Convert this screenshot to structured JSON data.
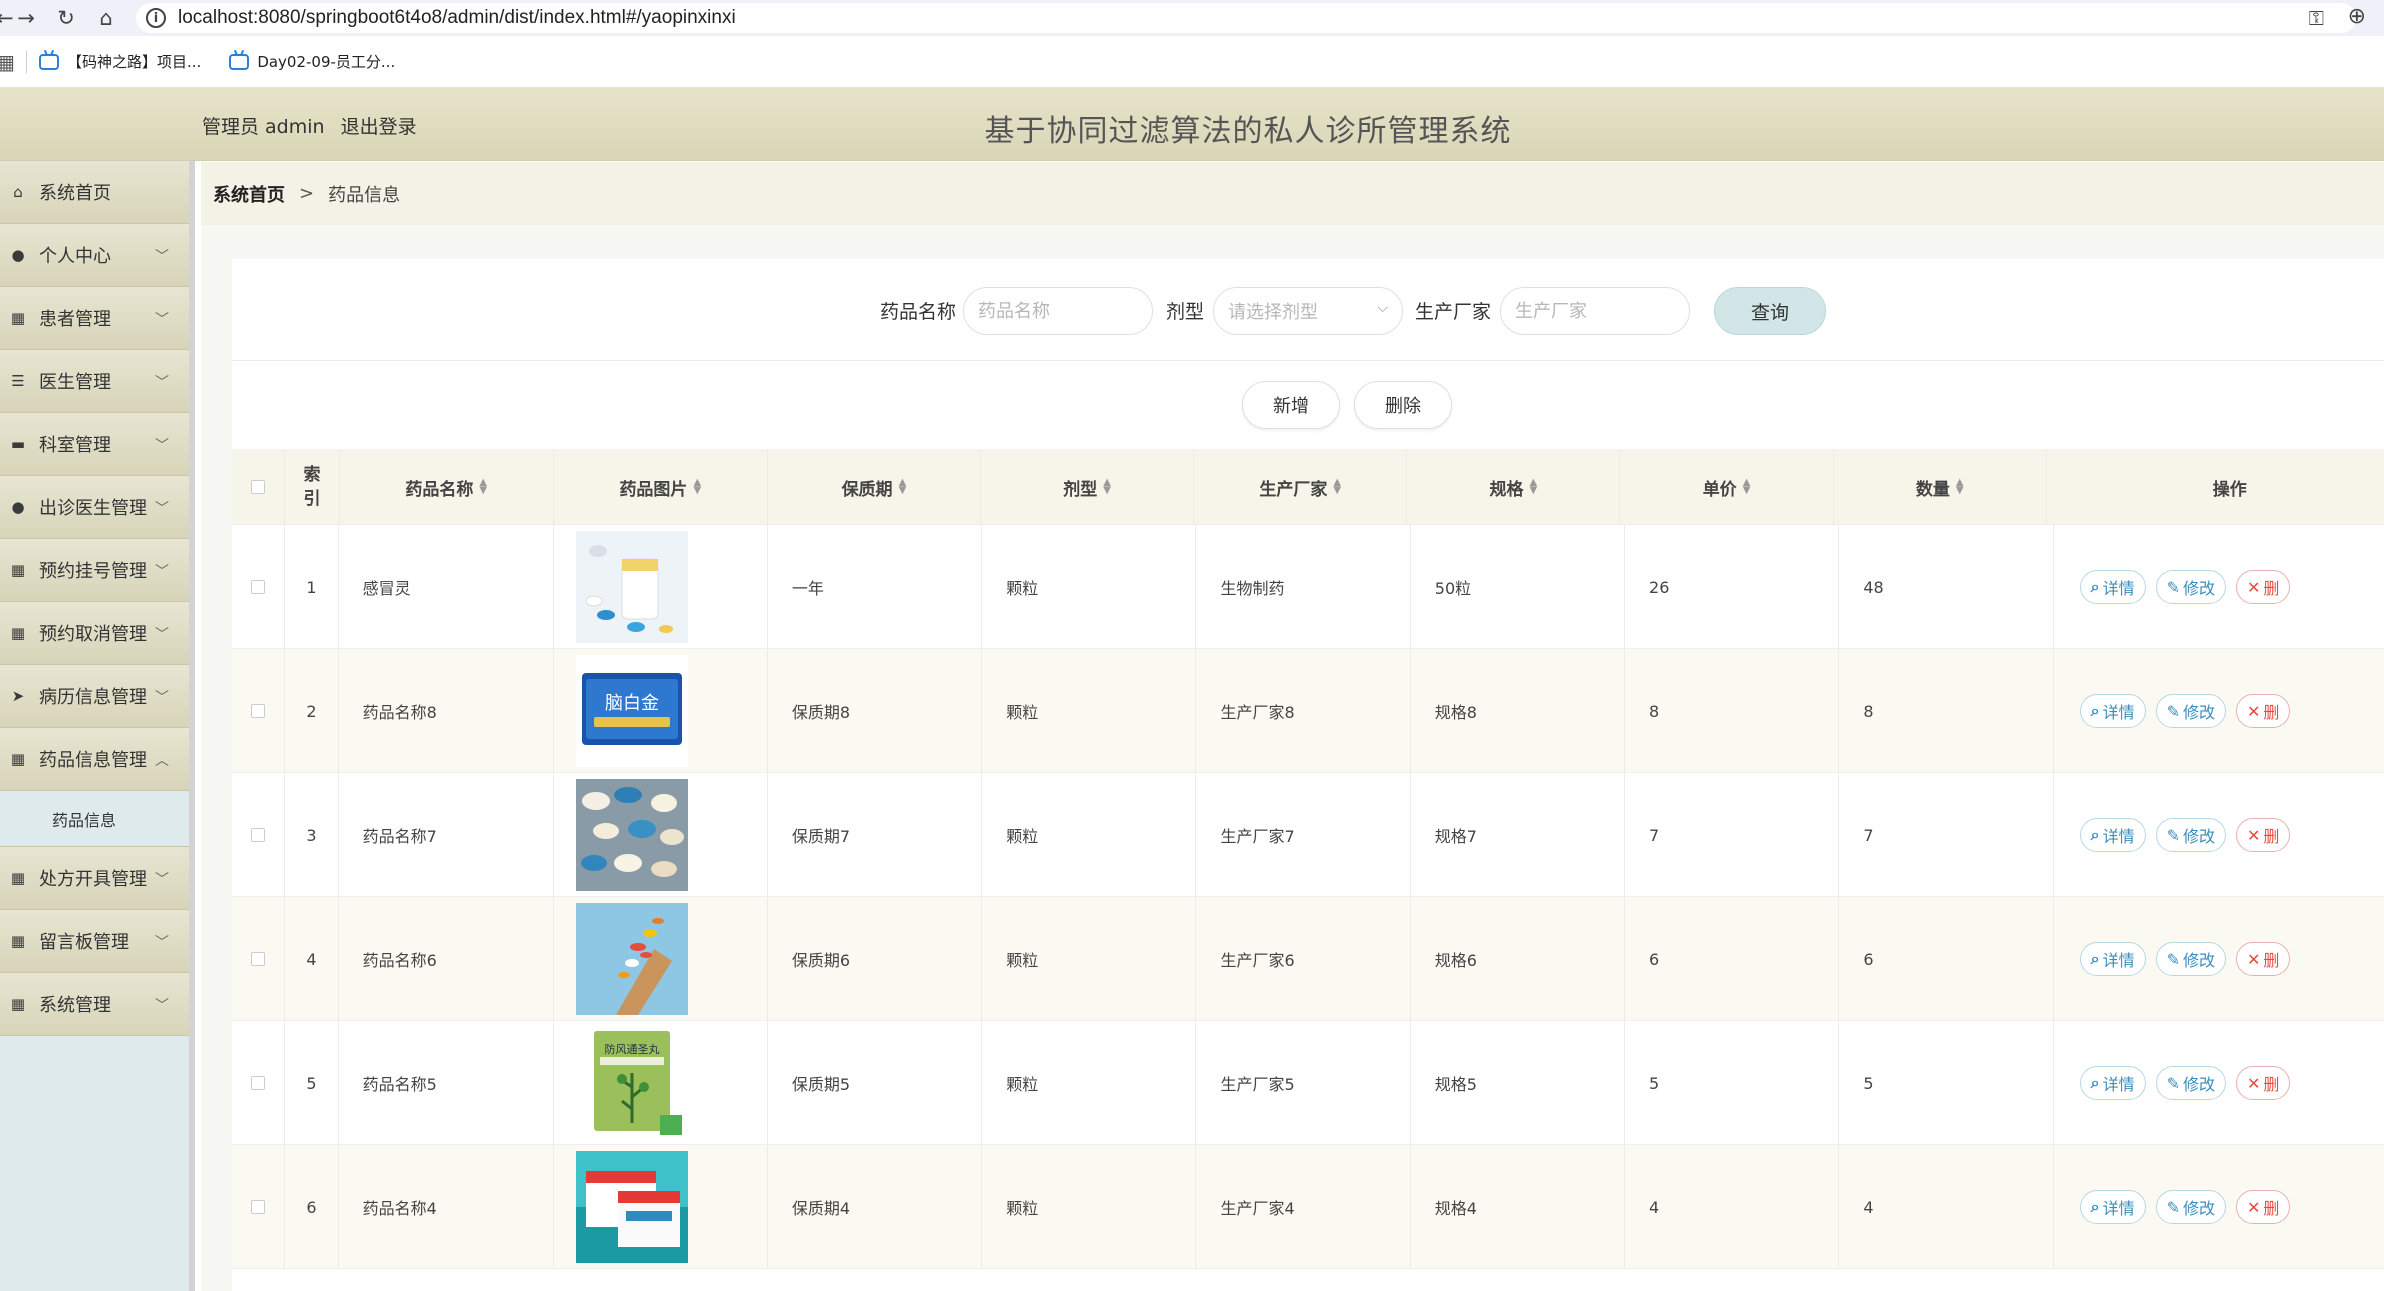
{
  "browser": {
    "url": "localhost:8080/springboot6t4o8/admin/dist/index.html#/yaopinxinxi",
    "bookmarks": [
      "【码神之路】项目...",
      "Day02-09-员工分..."
    ]
  },
  "header": {
    "user_label": "管理员 admin",
    "logout_label": "退出登录",
    "title": "基于协同过滤算法的私人诊所管理系统"
  },
  "sidebar": {
    "items": [
      {
        "label": "系统首页",
        "icon": "home-icon",
        "glyph": "⌂"
      },
      {
        "label": "个人中心",
        "icon": "user-icon",
        "glyph": "●"
      },
      {
        "label": "患者管理",
        "icon": "grid-icon",
        "glyph": "▦"
      },
      {
        "label": "医生管理",
        "icon": "sliders-icon",
        "glyph": "☰"
      },
      {
        "label": "科室管理",
        "icon": "monitor-icon",
        "glyph": "▬"
      },
      {
        "label": "出诊医生管理",
        "icon": "pin-icon",
        "glyph": "●"
      },
      {
        "label": "预约挂号管理",
        "icon": "grid-icon",
        "glyph": "▦"
      },
      {
        "label": "预约取消管理",
        "icon": "grid-icon",
        "glyph": "▦"
      },
      {
        "label": "病历信息管理",
        "icon": "send-icon",
        "glyph": "➤"
      },
      {
        "label": "药品信息管理",
        "icon": "grid-icon",
        "glyph": "▦"
      },
      {
        "label": "处方开具管理",
        "icon": "grid-icon",
        "glyph": "▦"
      },
      {
        "label": "留言板管理",
        "icon": "grid-icon",
        "glyph": "▦"
      },
      {
        "label": "系统管理",
        "icon": "grid-icon",
        "glyph": "▦"
      }
    ],
    "submenu_label": "药品信息"
  },
  "breadcrumb": {
    "home": "系统首页",
    "separator": ">",
    "current": "药品信息"
  },
  "search": {
    "name_label": "药品名称",
    "name_placeholder": "药品名称",
    "form_label": "剂型",
    "form_placeholder": "请选择剂型",
    "maker_label": "生产厂家",
    "maker_placeholder": "生产厂家",
    "query_label": "查询"
  },
  "actions": {
    "add_label": "新增",
    "delete_label": "删除"
  },
  "table": {
    "headers": {
      "index": "索引",
      "name": "药品名称",
      "image": "药品图片",
      "shelf": "保质期",
      "form": "剂型",
      "maker": "生产厂家",
      "spec": "规格",
      "price": "单价",
      "qty": "数量",
      "ops": "操作"
    },
    "op_labels": {
      "detail": "详情",
      "edit": "修改",
      "delete": "删"
    },
    "rows": [
      {
        "idx": "1",
        "name": "感冒灵",
        "shelf": "一年",
        "form": "颗粒",
        "maker": "生物制药",
        "spec": "50粒",
        "price": "26",
        "qty": "48"
      },
      {
        "idx": "2",
        "name": "药品名称8",
        "shelf": "保质期8",
        "form": "颗粒",
        "maker": "生产厂家8",
        "spec": "规格8",
        "price": "8",
        "qty": "8"
      },
      {
        "idx": "3",
        "name": "药品名称7",
        "shelf": "保质期7",
        "form": "颗粒",
        "maker": "生产厂家7",
        "spec": "规格7",
        "price": "7",
        "qty": "7"
      },
      {
        "idx": "4",
        "name": "药品名称6",
        "shelf": "保质期6",
        "form": "颗粒",
        "maker": "生产厂家6",
        "spec": "规格6",
        "price": "6",
        "qty": "6"
      },
      {
        "idx": "5",
        "name": "药品名称5",
        "shelf": "保质期5",
        "form": "颗粒",
        "maker": "生产厂家5",
        "spec": "规格5",
        "price": "5",
        "qty": "5"
      },
      {
        "idx": "6",
        "name": "药品名称4",
        "shelf": "保质期4",
        "form": "颗粒",
        "maker": "生产厂家4",
        "spec": "规格4",
        "price": "4",
        "qty": "4"
      }
    ]
  },
  "thumb_labels": {
    "row2": "脑白金",
    "row5": "防风通圣丸"
  }
}
